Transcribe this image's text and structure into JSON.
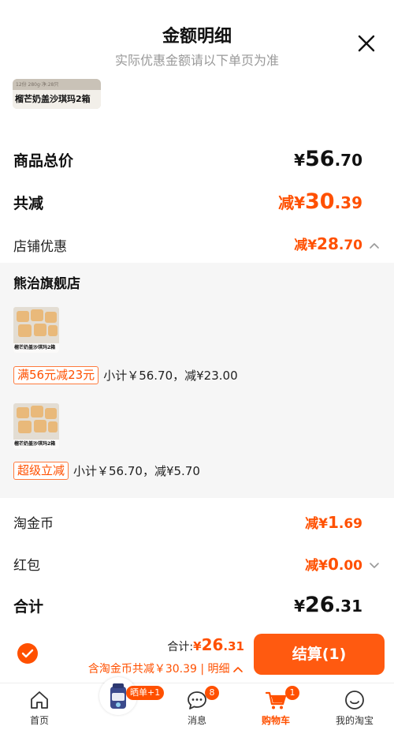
{
  "header": {
    "title": "金额明细",
    "subtitle": "实际优惠金额请以下单页为准"
  },
  "top_product": {
    "band_text": "12份 280g·净:28只",
    "caption": "榴芒奶盖沙琪玛2箱"
  },
  "summary": {
    "goods_total": {
      "label": "商品总价",
      "sym": "¥",
      "int": "56",
      "dec": ".70"
    },
    "total_discount": {
      "label": "共减",
      "prefix": "减",
      "sym": "¥",
      "int": "30",
      "dec": ".39"
    },
    "shop_discount": {
      "label": "店铺优惠",
      "prefix": "减",
      "sym": "¥",
      "int": "28",
      "dec": ".70"
    }
  },
  "shop": {
    "name": "熊治旗舰店",
    "items": [
      {
        "img_caption": "榴芒奶盖沙琪玛2箱",
        "tag": "满56元减23元",
        "detail": "小计￥56.70，减¥23.00"
      },
      {
        "img_caption": "榴芒奶盖沙琪玛2箱",
        "tag": "超级立减",
        "detail": "小计￥56.70，减¥5.70"
      }
    ]
  },
  "extras": {
    "taojinbi": {
      "label": "淘金币",
      "prefix": "减",
      "sym": "¥",
      "int": "1",
      "dec": ".69"
    },
    "hongbao": {
      "label": "红包",
      "prefix": "减",
      "sym": "¥",
      "int": "0",
      "dec": ".00"
    },
    "total": {
      "label": "合计",
      "sym": "¥",
      "int": "26",
      "dec": ".31"
    }
  },
  "bottom_bar": {
    "total_label": "合计:",
    "total_sym": "¥",
    "total_int": "26",
    "total_dec": ".31",
    "save_text": "含淘金币共减￥30.39 | 明细",
    "checkout_label": "结算(1)"
  },
  "tabs": [
    {
      "label": "首页",
      "icon": "home-icon"
    },
    {
      "label": "",
      "icon": "product-photo",
      "badge": "晒单+1"
    },
    {
      "label": "消息",
      "icon": "message-icon",
      "badge": "8"
    },
    {
      "label": "购物车",
      "icon": "cart-icon",
      "badge": "1"
    },
    {
      "label": "我的淘宝",
      "icon": "profile-icon"
    }
  ],
  "colors": {
    "accent": "#ff5000",
    "checkout_button": "#ff5a10",
    "panel_bg": "#f6f6f6"
  }
}
